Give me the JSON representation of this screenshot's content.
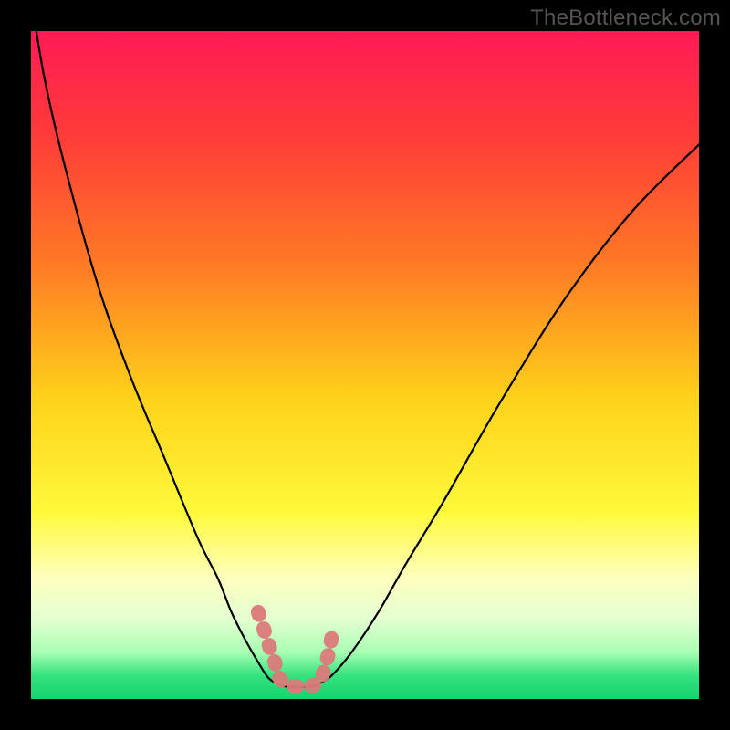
{
  "watermark": "TheBottleneck.com",
  "chart_data": {
    "type": "line",
    "title": "",
    "xlabel": "",
    "ylabel": "",
    "xlim": [
      0,
      100
    ],
    "ylim": [
      0,
      100
    ],
    "grid": false,
    "series": [
      {
        "name": "left-branch",
        "x": [
          0,
          2,
          5,
          10,
          15,
          20,
          25,
          28,
          30,
          32,
          34,
          35.5,
          37
        ],
        "y": [
          105,
          93,
          80,
          62,
          48,
          36,
          24,
          18,
          13,
          9,
          5.5,
          3.2,
          2.2
        ]
      },
      {
        "name": "valley-floor",
        "x": [
          37,
          38,
          39,
          40,
          41,
          42,
          43
        ],
        "y": [
          2.2,
          1.9,
          1.8,
          1.8,
          1.8,
          1.9,
          2.2
        ]
      },
      {
        "name": "right-branch",
        "x": [
          43,
          45,
          48,
          52,
          56,
          62,
          70,
          80,
          90,
          100
        ],
        "y": [
          2.2,
          3.5,
          7,
          13,
          20,
          30,
          44,
          60,
          73,
          83
        ]
      }
    ],
    "highlight_segment": {
      "name": "valley-highlight",
      "color": "#db7a7a",
      "points_x": [
        34,
        35,
        35.8,
        36.5,
        37,
        38,
        39,
        40,
        41,
        42,
        43,
        43.6,
        44.2,
        44.8,
        45.2
      ],
      "points_y": [
        13,
        10,
        7.5,
        5.5,
        3.5,
        2.3,
        2.0,
        1.9,
        1.9,
        2.0,
        2.3,
        3.5,
        5.5,
        8,
        11
      ]
    },
    "gradient_stops": [
      {
        "offset": 0.0,
        "color": "#ff1a55"
      },
      {
        "offset": 0.15,
        "color": "#ff3a3a"
      },
      {
        "offset": 0.35,
        "color": "#ff7a25"
      },
      {
        "offset": 0.55,
        "color": "#ffd21a"
      },
      {
        "offset": 0.72,
        "color": "#fff93a"
      },
      {
        "offset": 0.82,
        "color": "#fdffbf"
      },
      {
        "offset": 0.88,
        "color": "#e4ffd1"
      },
      {
        "offset": 0.93,
        "color": "#a8ffb3"
      },
      {
        "offset": 0.965,
        "color": "#34e27e"
      },
      {
        "offset": 1.0,
        "color": "#17d36e"
      }
    ]
  }
}
